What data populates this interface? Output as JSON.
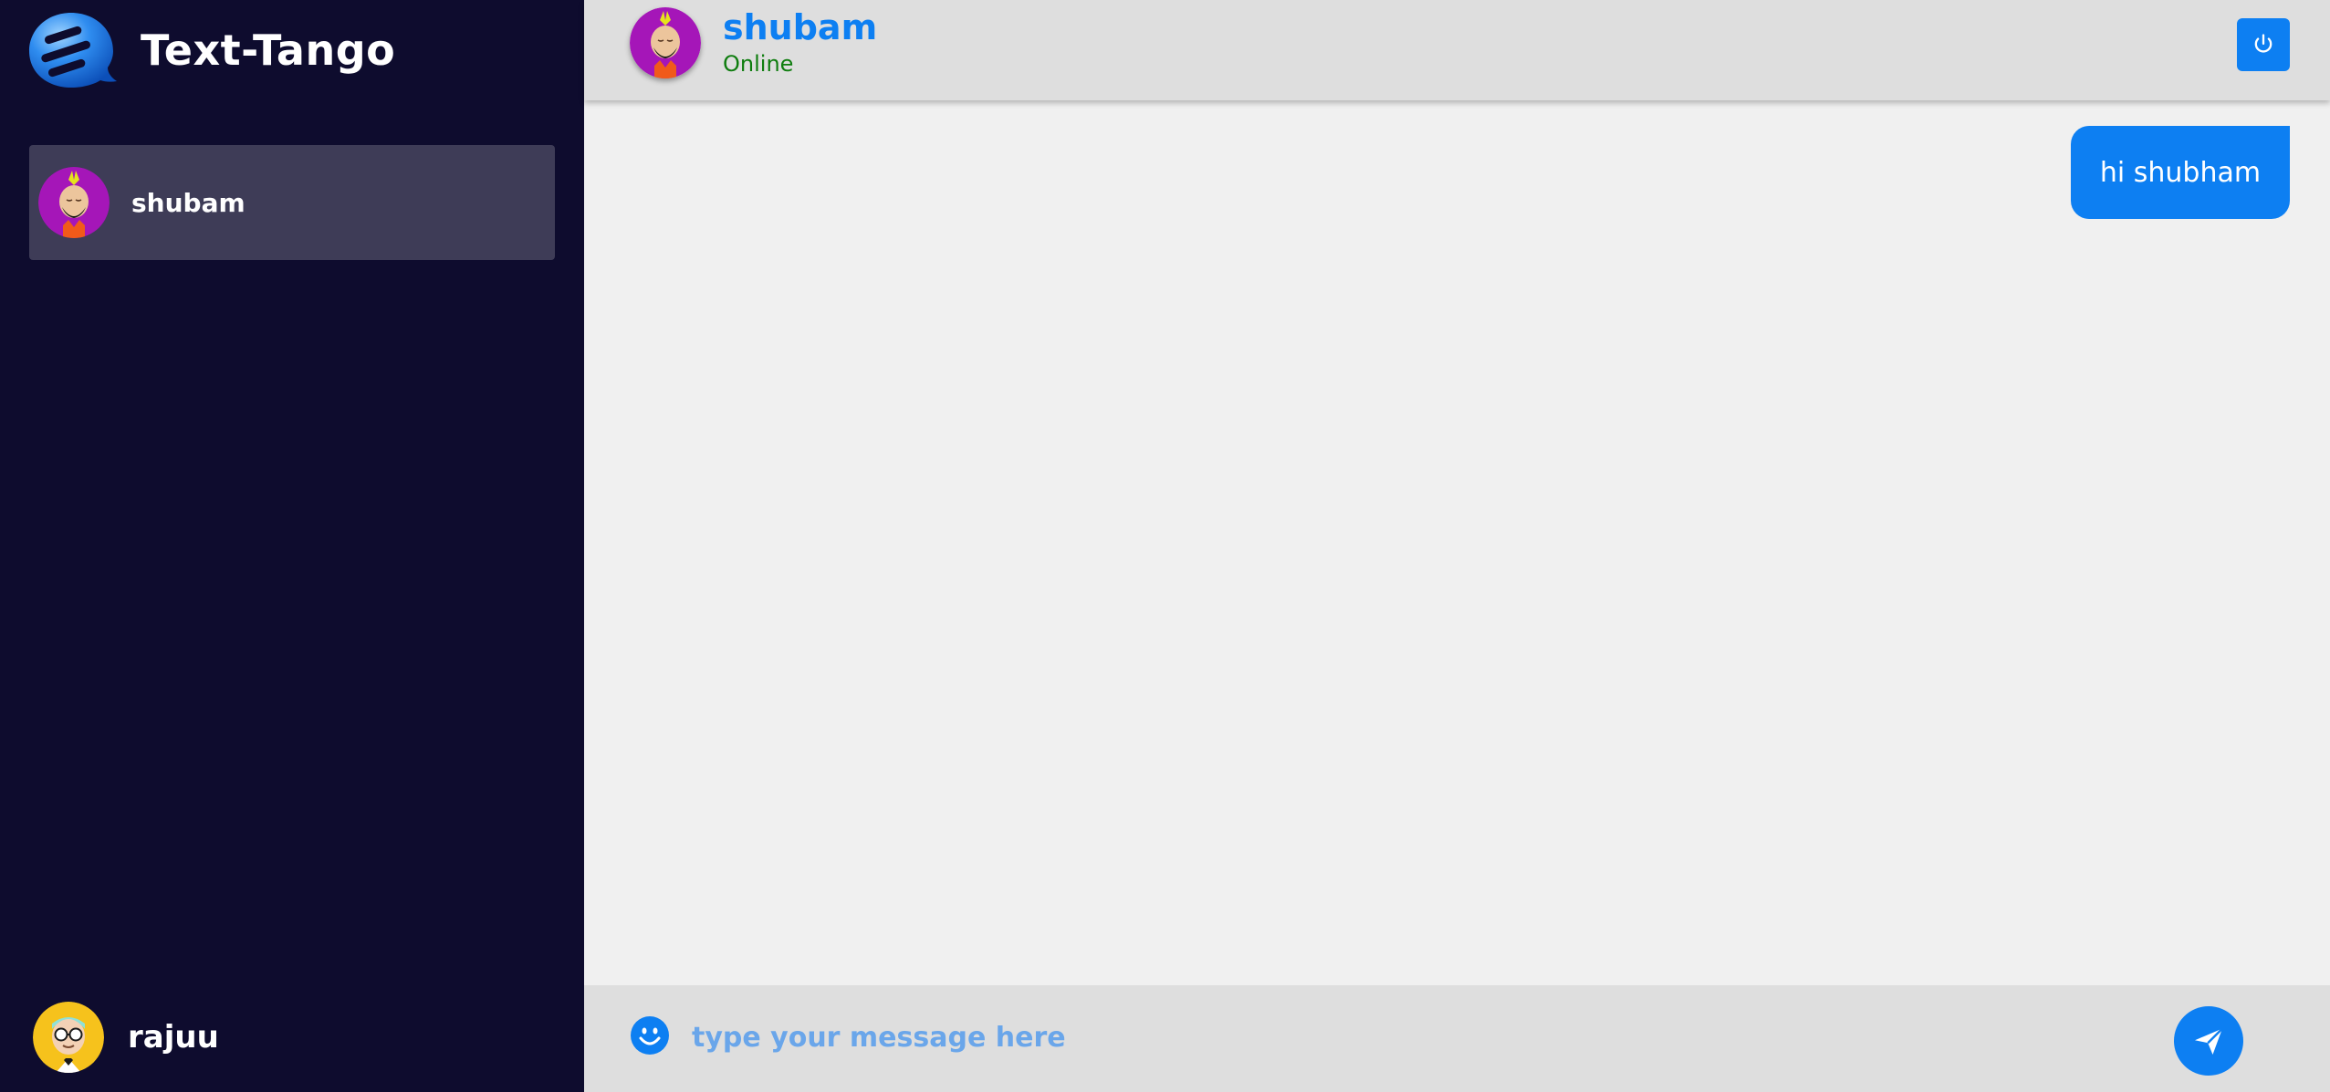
{
  "app": {
    "name": "Text-Tango",
    "logo_icon": "chat-bubble-logo-icon"
  },
  "sidebar": {
    "contacts": [
      {
        "name": "shubam",
        "avatar": "turban-man-avatar"
      }
    ],
    "current_user": {
      "name": "rajuu",
      "avatar": "glasses-man-avatar"
    }
  },
  "chat": {
    "header": {
      "name": "shubam",
      "status": "Online",
      "logout_icon": "power-icon"
    },
    "messages": [
      {
        "direction": "outgoing",
        "text": "hi shubham"
      }
    ],
    "composer": {
      "placeholder": "type your message here",
      "value": "",
      "emoji_icon": "smiley-icon",
      "send_icon": "send-icon"
    }
  },
  "colors": {
    "sidebar_bg": "#0e0c2e",
    "accent": "#0d7ff2",
    "online": "#0f7d0f",
    "contact_selected_bg": "#3e3c57"
  }
}
